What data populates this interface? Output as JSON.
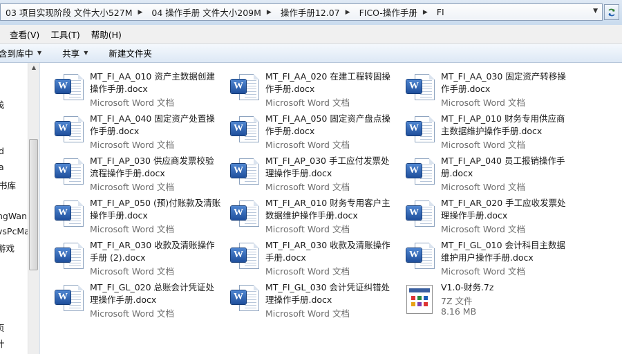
{
  "address": {
    "crumbs": [
      "03 项目实现阶段 文件大小527M",
      "04 操作手册 文件大小209M",
      "操作手册12.07",
      "FICO-操作手册",
      "FI"
    ]
  },
  "menu": [
    "查看(V)",
    "工具(T)",
    "帮助(H)"
  ],
  "commands": {
    "include_library": "含到库中",
    "share": "共享",
    "new_folder": "新建文件夹"
  },
  "nav": [
    "戋",
    "d",
    "a",
    "书库",
    "ngWan",
    "vsPcMa",
    "游戏",
    "页",
    "计"
  ],
  "files": [
    {
      "name": "MT_FI_AA_010 资产主数据创建操作手册.docx",
      "type": "Microsoft Word 文档",
      "icon": "word-doc-icon"
    },
    {
      "name": "MT_FI_AA_020 在建工程转固操作手册.docx",
      "type": "Microsoft Word 文档",
      "icon": "word-doc-icon"
    },
    {
      "name": "MT_FI_AA_030 固定资产转移操作手册.docx",
      "type": "Microsoft Word 文档",
      "icon": "word-doc-icon"
    },
    {
      "name": "MT_FI_AA_040 固定资产处置操作手册.docx",
      "type": "Microsoft Word 文档",
      "icon": "word-doc-icon"
    },
    {
      "name": "MT_FI_AA_050 固定资产盘点操作手册.docx",
      "type": "Microsoft Word 文档",
      "icon": "word-doc-icon"
    },
    {
      "name": "MT_FI_AP_010 财务专用供应商主数据维护操作手册.docx",
      "type": "Microsoft Word 文档",
      "icon": "word-doc-icon"
    },
    {
      "name": "MT_FI_AP_030 供应商发票校验流程操作手册.docx",
      "type": "Microsoft Word 文档",
      "icon": "word-doc-icon"
    },
    {
      "name": "MT_FI_AP_030 手工应付发票处理操作手册.docx",
      "type": "Microsoft Word 文档",
      "icon": "word-doc-icon"
    },
    {
      "name": "MT_FI_AP_040 员工报销操作手册.docx",
      "type": "Microsoft Word 文档",
      "icon": "word-doc-icon"
    },
    {
      "name": "MT_FI_AP_050 (预)付账款及清账操作手册.docx",
      "type": "Microsoft Word 文档",
      "icon": "word-doc-icon"
    },
    {
      "name": "MT_FI_AR_010 财务专用客户主数据维护操作手册.docx",
      "type": "Microsoft Word 文档",
      "icon": "word-doc-icon"
    },
    {
      "name": "MT_FI_AR_020 手工应收发票处理操作手册.docx",
      "type": "Microsoft Word 文档",
      "icon": "word-doc-icon"
    },
    {
      "name": "MT_FI_AR_030 收款及清账操作手册 (2).docx",
      "type": "Microsoft Word 文档",
      "icon": "word-doc-icon"
    },
    {
      "name": "MT_FI_AR_030 收款及清账操作手册.docx",
      "type": "Microsoft Word 文档",
      "icon": "word-doc-icon"
    },
    {
      "name": "MT_FI_GL_010 会计科目主数据维护用户操作手册.docx",
      "type": "Microsoft Word 文档",
      "icon": "word-doc-icon"
    },
    {
      "name": "MT_FI_GL_020 总账会计凭证处理操作手册.docx",
      "type": "Microsoft Word 文档",
      "icon": "word-doc-icon"
    },
    {
      "name": "MT_FI_GL_030 会计凭证纠错处理操作手册.docx",
      "type": "Microsoft Word 文档",
      "icon": "word-doc-icon"
    },
    {
      "name": "V1.0-财务.7z",
      "type": "7Z 文件",
      "size": "8.16 MB",
      "icon": "archive-icon"
    }
  ],
  "colors": {
    "word_badge": "#2a5caa",
    "secondary_text": "#6d6d6d",
    "toolbar": "#dde8f5"
  }
}
